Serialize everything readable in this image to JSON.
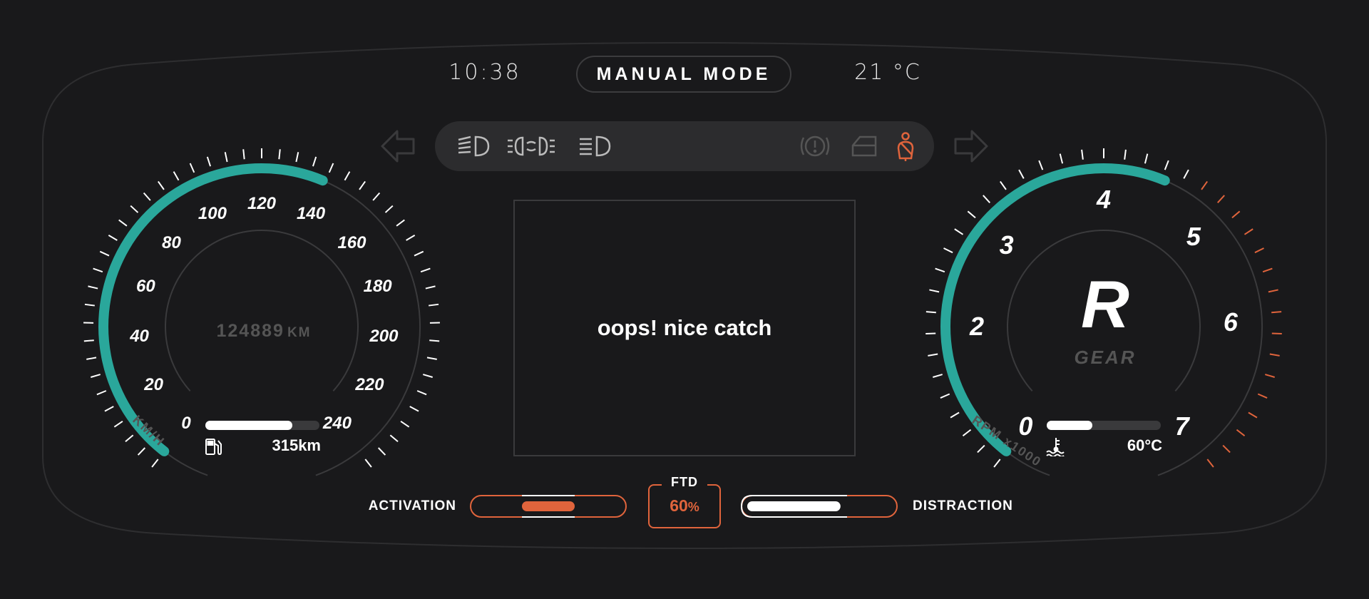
{
  "header": {
    "time": "10:38",
    "mode": "MANUAL MODE",
    "temperature": "21 °C"
  },
  "indicators": {
    "left_turn_icon": "arrow-left-icon",
    "right_turn_icon": "arrow-right-icon",
    "lights": [
      "high-beam-icon",
      "fog-light-icon",
      "low-beam-icon"
    ],
    "warnings": [
      "brake-warning-icon",
      "door-open-icon",
      "seatbelt-icon"
    ],
    "warning_color": "#e0643c"
  },
  "message": "oops! nice catch",
  "speedometer": {
    "labels": [
      "0",
      "20",
      "40",
      "60",
      "80",
      "100",
      "120",
      "140",
      "160",
      "180",
      "200",
      "220",
      "240"
    ],
    "unit": "KM/H",
    "speed_fraction": 0.58,
    "odometer": "124889",
    "odometer_unit": "KM",
    "fuel_fraction": 0.76,
    "range": "315km",
    "accent": "#2aa79b"
  },
  "tachometer": {
    "labels": [
      "0",
      "2",
      "3",
      "4",
      "5",
      "6",
      "7"
    ],
    "unit": "RPM x1000",
    "rpm_fraction": 0.58,
    "gear": "R",
    "gear_label": "GEAR",
    "coolant_fraction": 0.4,
    "coolant_temp": "60°C",
    "redline_color": "#e0643c"
  },
  "driver": {
    "activation_label": "ACTIVATION",
    "activation_fraction": 0.5,
    "ftd_label": "FTD",
    "ftd_value": "60",
    "ftd_unit": "%",
    "distraction_label": "DISTRACTION",
    "distraction_fraction": 0.6
  }
}
